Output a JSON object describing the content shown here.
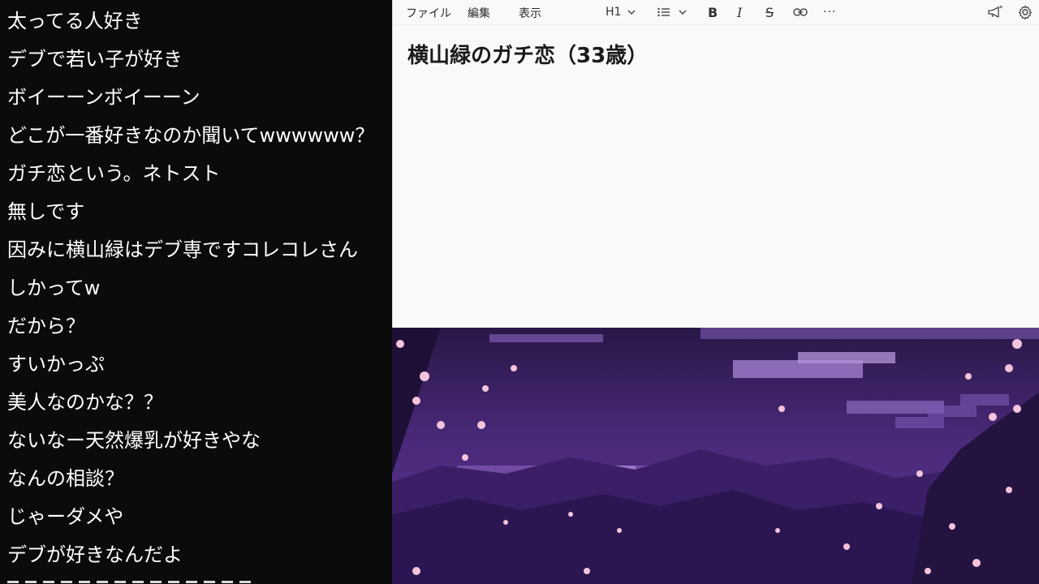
{
  "chat": {
    "messages": [
      "太ってる人好き",
      "デブで若い子が好き",
      "ボイーーンボイーーン",
      "どこが一番好きなのか聞いてwwwwww？",
      "ガチ恋という。ネトスト",
      "無しです",
      "因みに横山緑はデブ専ですコレコレさん",
      "しかってw",
      "だから？",
      "すいかっぷ",
      "美人なのかな？？",
      "ないなー天然爆乳が好きやな",
      "なんの相談？",
      "じゃーダメや",
      "デブが好きなんだよ"
    ]
  },
  "editor": {
    "menu": {
      "file": "ファイル",
      "edit": "編集",
      "view": "表示"
    },
    "toolbar": {
      "heading": "H1",
      "heading_icon": "chevron-down-icon",
      "list_icon": "list-icon",
      "bold": "B",
      "italic": "I",
      "strike": "S",
      "link_icon": "link-icon",
      "more": "···",
      "megaphone_icon": "megaphone-icon",
      "settings_icon": "gear-icon"
    },
    "document_title": "横山緑のガチ恋（33歳）"
  },
  "colors": {
    "chat_bg": "#0b0b0b",
    "chat_text": "#ffffff",
    "editor_bg": "#f9f9f9",
    "wallpaper_sky": "#3a1f5c",
    "wallpaper_blossom": "#f3c4dc"
  }
}
